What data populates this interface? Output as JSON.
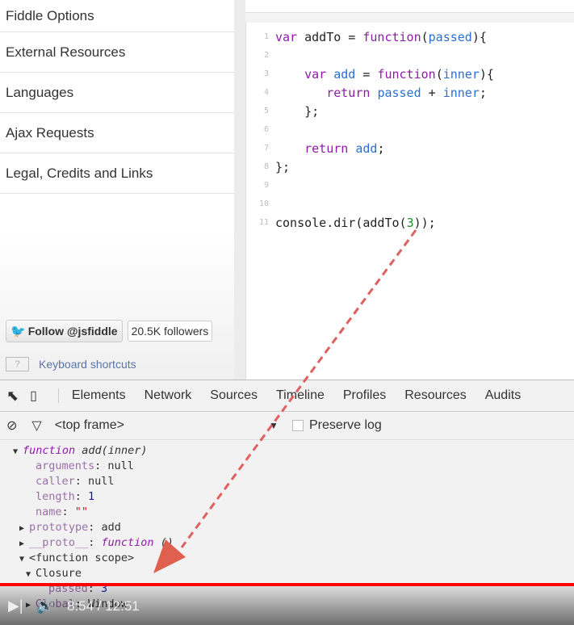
{
  "sidebar": {
    "items": [
      "Fiddle Options",
      "External Resources",
      "Languages",
      "Ajax Requests",
      "Legal, Credits and Links"
    ],
    "follow_label": "Follow @jsfiddle",
    "followers": "20.5K followers",
    "kbd_key": "?",
    "kbd_label": "Keyboard shortcuts"
  },
  "editor": {
    "lines": [
      [
        [
          "kw",
          "var "
        ],
        [
          "pl",
          "addTo = "
        ],
        [
          "kw",
          "function"
        ],
        [
          "pl",
          "("
        ],
        [
          "vr",
          "passed"
        ],
        [
          "pl",
          "){"
        ]
      ],
      [],
      [
        [
          "pl",
          "    "
        ],
        [
          "kw",
          "var "
        ],
        [
          "vr",
          "add"
        ],
        [
          "pl",
          " = "
        ],
        [
          "kw",
          "function"
        ],
        [
          "pl",
          "("
        ],
        [
          "vr",
          "inner"
        ],
        [
          "pl",
          "){"
        ]
      ],
      [
        [
          "pl",
          "       "
        ],
        [
          "kw",
          "return "
        ],
        [
          "vr",
          "passed"
        ],
        [
          "pl",
          " + "
        ],
        [
          "vr",
          "inner"
        ],
        [
          "pl",
          ";"
        ]
      ],
      [
        [
          "pl",
          "    };"
        ]
      ],
      [],
      [
        [
          "pl",
          "    "
        ],
        [
          "kw",
          "return "
        ],
        [
          "vr",
          "add"
        ],
        [
          "pl",
          ";"
        ]
      ],
      [
        [
          "pl",
          "};"
        ]
      ],
      [],
      [],
      [
        [
          "pl",
          "console.dir(addTo("
        ],
        [
          "nm",
          "3"
        ],
        [
          "pl",
          "));"
        ]
      ]
    ]
  },
  "devtools": {
    "tabs": [
      "Elements",
      "Network",
      "Sources",
      "Timeline",
      "Profiles",
      "Resources",
      "Audits"
    ],
    "frame": "<top frame>",
    "preserve_log": "Preserve log",
    "console": [
      {
        "indent": 2,
        "arrow": "▼",
        "parts": [
          [
            "fn",
            "function "
          ],
          [
            "fnn",
            "add(inner)"
          ]
        ]
      },
      {
        "indent": 4,
        "parts": [
          [
            "prop",
            "arguments"
          ],
          [
            "",
            ": null"
          ]
        ]
      },
      {
        "indent": 4,
        "parts": [
          [
            "prop",
            "caller"
          ],
          [
            "",
            ": null"
          ]
        ]
      },
      {
        "indent": 4,
        "parts": [
          [
            "prop",
            "length"
          ],
          [
            "",
            ": "
          ],
          [
            "num",
            "1"
          ]
        ]
      },
      {
        "indent": 4,
        "parts": [
          [
            "prop",
            "name"
          ],
          [
            "",
            ": "
          ],
          [
            "str",
            "\"\""
          ]
        ]
      },
      {
        "indent": 3,
        "arrow": "▶",
        "parts": [
          [
            "prop",
            "prototype"
          ],
          [
            "",
            ": add"
          ]
        ]
      },
      {
        "indent": 3,
        "arrow": "▶",
        "parts": [
          [
            "prop",
            "__proto__"
          ],
          [
            "",
            ": "
          ],
          [
            "fn",
            "function"
          ],
          [
            "fnn",
            " ()"
          ]
        ]
      },
      {
        "indent": 3,
        "arrow": "▼",
        "parts": [
          [
            "",
            "<function scope>"
          ]
        ]
      },
      {
        "indent": 4,
        "arrow": "▼",
        "parts": [
          [
            "",
            "Closure"
          ]
        ]
      },
      {
        "indent": 6,
        "parts": [
          [
            "prop",
            "passed"
          ],
          [
            "",
            ": "
          ],
          [
            "num",
            "3"
          ]
        ]
      },
      {
        "indent": 4,
        "arrow": "▶",
        "parts": [
          [
            "prop",
            "Global"
          ],
          [
            "",
            ": Window"
          ]
        ]
      }
    ]
  },
  "video": {
    "time": "8:54 / 12:51",
    "progress_percent": 100
  }
}
